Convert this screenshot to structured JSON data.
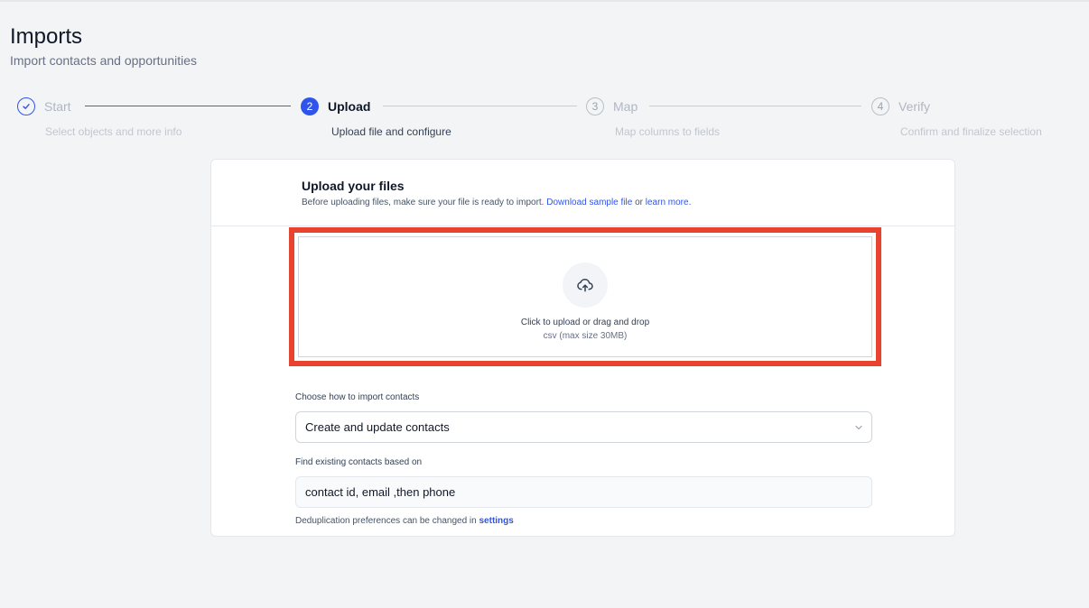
{
  "header": {
    "title": "Imports",
    "subtitle": "Import contacts and opportunities"
  },
  "stepper": {
    "steps": [
      {
        "number": "",
        "label": "Start",
        "description": "Select objects and more info",
        "status": "done"
      },
      {
        "number": "2",
        "label": "Upload",
        "description": "Upload file and configure",
        "status": "current"
      },
      {
        "number": "3",
        "label": "Map",
        "description": "Map columns to fields",
        "status": "pending"
      },
      {
        "number": "4",
        "label": "Verify",
        "description": "Confirm and finalize selection",
        "status": "pending"
      }
    ]
  },
  "upload": {
    "title": "Upload your files",
    "description_prefix": "Before uploading files, make sure your file is ready to import. ",
    "sample_link": "Download sample file",
    "or_text": " or ",
    "learn_link": "learn more.",
    "dropzone_text": "Click to upload or drag and drop",
    "dropzone_hint": "csv (max size 30MB)",
    "icon": "cloud-upload-icon"
  },
  "import_options": {
    "mode_label": "Choose how to import contacts",
    "mode_value": "Create and update contacts",
    "match_label": "Find existing contacts based on",
    "match_value": "contact id, email ,then phone",
    "note_prefix": "Deduplication preferences can be changed in ",
    "note_link": "settings"
  },
  "colors": {
    "primary": "#2f54eb",
    "highlight": "#e8432e",
    "background": "#f3f4f6"
  }
}
